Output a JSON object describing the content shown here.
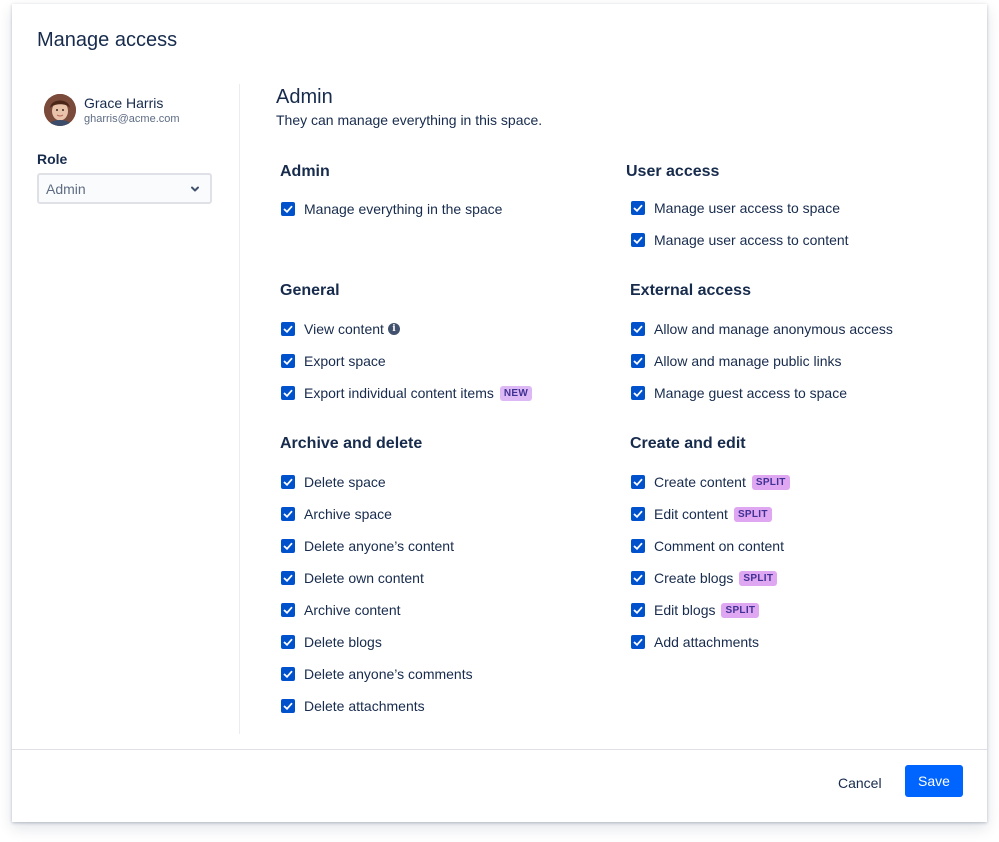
{
  "dialog": {
    "title": "Manage access"
  },
  "user": {
    "name": "Grace Harris",
    "email": "gharris@acme.com"
  },
  "role": {
    "label": "Role",
    "selected": "Admin"
  },
  "main": {
    "title": "Admin",
    "description": "They can manage everything in this space."
  },
  "sections": {
    "admin": {
      "title": "Admin",
      "items": [
        {
          "label": "Manage everything in the space",
          "checked": true
        }
      ]
    },
    "user_access": {
      "title": "User access",
      "items": [
        {
          "label": "Manage user access to space",
          "checked": true
        },
        {
          "label": "Manage user access to content",
          "checked": true
        }
      ]
    },
    "general": {
      "title": "General",
      "items": [
        {
          "label": "View content",
          "checked": true
        },
        {
          "label": "Export space",
          "checked": true
        },
        {
          "label": "Export individual content items",
          "checked": true,
          "badge": "NEW"
        }
      ]
    },
    "external_access": {
      "title": "External access",
      "items": [
        {
          "label": "Allow and manage anonymous access",
          "checked": true
        },
        {
          "label": "Allow and manage public links",
          "checked": true
        },
        {
          "label": "Manage guest access to space",
          "checked": true
        }
      ]
    },
    "archive_delete": {
      "title": "Archive and delete",
      "items": [
        {
          "label": "Delete space",
          "checked": true
        },
        {
          "label": "Archive space",
          "checked": true
        },
        {
          "label": "Delete anyone’s content",
          "checked": true
        },
        {
          "label": "Delete own content",
          "checked": true
        },
        {
          "label": "Archive content",
          "checked": true
        },
        {
          "label": "Delete blogs",
          "checked": true
        },
        {
          "label": "Delete anyone’s comments",
          "checked": true
        },
        {
          "label": "Delete attachments",
          "checked": true
        }
      ]
    },
    "create_edit": {
      "title": "Create and edit",
      "items": [
        {
          "label": "Create content",
          "checked": true,
          "badge": "SPLIT"
        },
        {
          "label": "Edit content",
          "checked": true,
          "badge": "SPLIT"
        },
        {
          "label": "Comment on content",
          "checked": true
        },
        {
          "label": "Create blogs",
          "checked": true,
          "badge": "SPLIT"
        },
        {
          "label": "Edit blogs",
          "checked": true,
          "badge": "SPLIT"
        },
        {
          "label": "Add attachments",
          "checked": true
        }
      ]
    }
  },
  "footer": {
    "cancel_label": "Cancel",
    "save_label": "Save"
  },
  "colors": {
    "primary": "#0065ff",
    "checkbox": "#0052cc",
    "badge": "#dfa6f2",
    "text": "#172b4d"
  }
}
